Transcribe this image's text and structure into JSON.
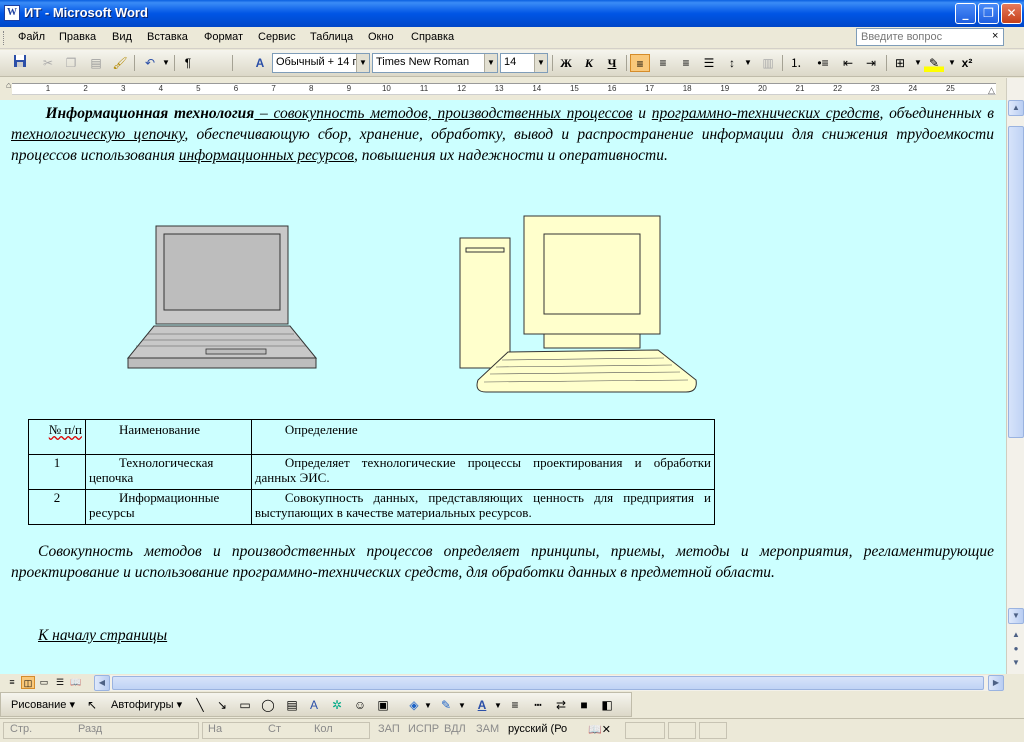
{
  "window": {
    "title": "ИТ - Microsoft Word",
    "app_icon": "W",
    "btn_min": "_",
    "btn_max": "❐",
    "btn_close": "✕"
  },
  "menu": {
    "items": [
      {
        "label": "Файл",
        "ul": "Ф"
      },
      {
        "label": "Правка",
        "ul": "П"
      },
      {
        "label": "Вид",
        "ul": "В"
      },
      {
        "label": "Вставка",
        "ul": "а"
      },
      {
        "label": "Формат",
        "ul": "о"
      },
      {
        "label": "Сервис",
        "ul": "С"
      },
      {
        "label": "Таблица",
        "ul": "Т"
      },
      {
        "label": "Окно",
        "ul": "О"
      },
      {
        "label": "Справка",
        "ul": "С"
      }
    ],
    "ask_placeholder": "Введите вопрос",
    "ask_close": "×"
  },
  "toolbar": {
    "style_value": "Обычный + 14 г",
    "font_value": "Times New Roman",
    "size_value": "14",
    "bold": "Ж",
    "italic": "К",
    "underline": "Ч",
    "pilcrow": "¶",
    "superscript": "x²"
  },
  "ruler": {
    "numbers": [
      "1",
      "2",
      "3",
      "4",
      "5",
      "6",
      "7",
      "8",
      "9",
      "10",
      "11",
      "12",
      "13",
      "14",
      "15",
      "16",
      "17",
      "18",
      "19",
      "20",
      "21",
      "22",
      "23",
      "24",
      "25"
    ]
  },
  "document": {
    "p1": {
      "bold_term": "Информационная технология",
      "link1": " – совокупность методов, производственных процессов",
      "and1": " и ",
      "link2": "программно-технических средств",
      "t2": ", объединенных в ",
      "link3": "технологическую цепочку",
      "t3": ", обеспечивающую сбор, хранение, обработку, вывод и распространение информации для снижения трудоемкости процессов использования ",
      "link4": "информационных ресурсов",
      "t4": ", повышения их надежности и оперативности."
    },
    "table": {
      "headers": [
        "№ п/п",
        "Наименование",
        "Определение"
      ],
      "rows": [
        {
          "num": "1",
          "name": "Технологическая цепочка",
          "def": "Определяет технологические процессы проектирования и обработки данных ЭИС."
        },
        {
          "num": "2",
          "name": "Информационные ресурсы",
          "def": "Совокупность данных, представляющих ценность для предприятия и выступающих в качестве материальных ресурсов."
        }
      ]
    },
    "p2": "Совокупность методов и производственных процессов определяет принципы, приемы, методы и мероприятия, регламентирующие проектирование и использование программно-технических средств, для обработки данных в предметной области.",
    "back_link": "К началу страницы"
  },
  "drawbar": {
    "draw_label": "Рисование",
    "shapes_label": "Автофигуры"
  },
  "status": {
    "page": "Стр.",
    "section": "Разд",
    "at": "На",
    "line": "Ст",
    "col": "Кол",
    "rec": "ЗАП",
    "trk": "ИСПР",
    "ext": "ВДЛ",
    "ovr": "ЗАМ",
    "lang": "русский (Ро"
  },
  "colors": {
    "doc_background": "#ccffff",
    "titlebar": "#0055e5"
  }
}
